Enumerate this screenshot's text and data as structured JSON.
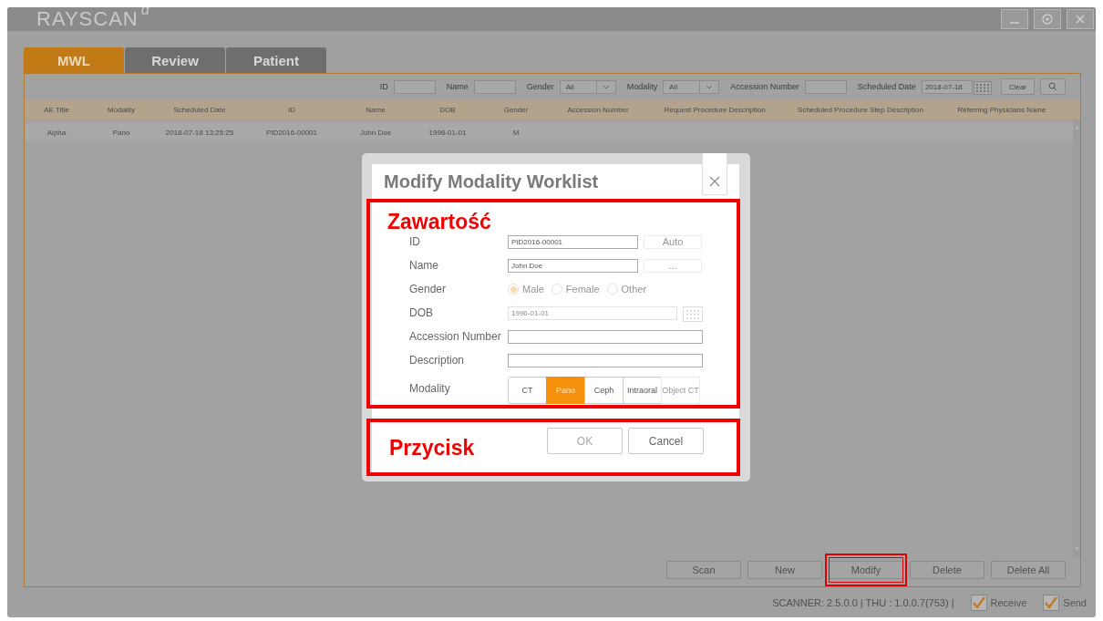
{
  "app": {
    "title": "RAYSCAN",
    "title_mark": "α"
  },
  "tabs": [
    {
      "label": "MWL",
      "selected": true
    },
    {
      "label": "Review",
      "selected": false
    },
    {
      "label": "Patient",
      "selected": false
    }
  ],
  "filters": [
    {
      "kind": "text",
      "label": "ID"
    },
    {
      "kind": "text",
      "label": "Name"
    },
    {
      "kind": "select",
      "label": "Gender",
      "value": "All"
    },
    {
      "kind": "select",
      "label": "Modality",
      "value": "All"
    },
    {
      "kind": "text",
      "label": "Accession Number"
    },
    {
      "kind": "date",
      "label": "Scheduled Date",
      "value": "2018-07-18"
    }
  ],
  "filter_buttons": [
    {
      "kind": "text",
      "label": "Clear"
    },
    {
      "kind": "search"
    }
  ],
  "table": {
    "columns": [
      "AE Title",
      "Modality",
      "Scheduled Date",
      "ID",
      "Name",
      "DOB",
      "Gender",
      "Accession Number",
      "Request Procedure Description",
      "Scheduled Procedure Step Description",
      "Referring Physicians Name"
    ],
    "rows": [
      {
        "cells": [
          "Alpha",
          "Pano",
          "2018-07-18 13:25:25",
          "PID2016-00001",
          "John Doe",
          "1996-01-01",
          "M"
        ]
      }
    ]
  },
  "actions": [
    {
      "label": "Scan",
      "highlighted": false
    },
    {
      "label": "New",
      "highlighted": false
    },
    {
      "label": "Modify",
      "highlighted": true
    },
    {
      "label": "Delete",
      "highlighted": false
    },
    {
      "label": "Delete All",
      "highlighted": false
    }
  ],
  "status": {
    "text": "SCANNER: 2.5.0.0 | THU : 1.0.0.7(753) |",
    "checks": [
      {
        "label": "Receive",
        "checked": true
      },
      {
        "label": "Send",
        "checked": true
      }
    ]
  },
  "dialog": {
    "title": "Modify Modality Worklist",
    "fields": [
      {
        "kind": "text",
        "label": "ID",
        "value": "PID2016-00001",
        "disabled": false,
        "button": {
          "label": "Auto",
          "disabled": true
        }
      },
      {
        "kind": "text",
        "label": "Name",
        "value": "John Doe",
        "disabled": false,
        "button": {
          "label": "...",
          "disabled": true
        }
      },
      {
        "kind": "radio",
        "label": "Gender",
        "disabled": true,
        "options": [
          {
            "label": "Male",
            "selected": true
          },
          {
            "label": "Female",
            "selected": false
          },
          {
            "label": "Other",
            "selected": false
          }
        ]
      },
      {
        "kind": "date",
        "label": "DOB",
        "value": "1996-01-01",
        "disabled": true
      },
      {
        "kind": "text",
        "label": "Accession Number",
        "disabled": false
      },
      {
        "kind": "text",
        "label": "Description",
        "disabled": false
      },
      {
        "kind": "segments",
        "label": "Modality",
        "options": [
          {
            "label": "CT",
            "selected": false,
            "disabled": false
          },
          {
            "label": "Pano",
            "selected": true,
            "disabled": false
          },
          {
            "label": "Ceph",
            "selected": false,
            "disabled": false
          },
          {
            "label": "Intraoral",
            "selected": false,
            "disabled": false
          },
          {
            "label": "Object CT",
            "selected": false,
            "disabled": true
          }
        ]
      }
    ],
    "buttons": [
      {
        "label": "OK",
        "disabled": true
      },
      {
        "label": "Cancel",
        "disabled": false
      }
    ]
  },
  "annotations": [
    {
      "label": "Zawartość"
    },
    {
      "label": "Przycisk"
    }
  ]
}
